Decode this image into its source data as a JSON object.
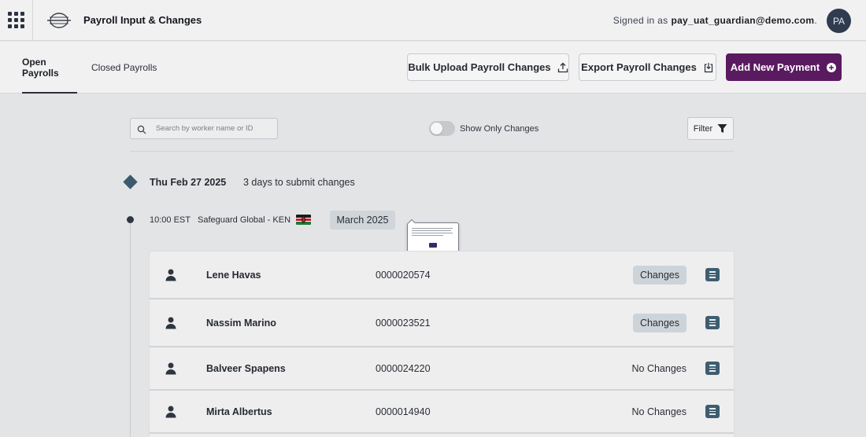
{
  "app": {
    "title": "Payroll Input & Changes",
    "signed_in_prefix": "Signed in as",
    "user_email": "pay_uat_guardian@demo.com",
    "signed_in_suffix": ".",
    "avatar_initials": "PA"
  },
  "tabs": [
    {
      "label": "Open Payrolls",
      "active": true
    },
    {
      "label": "Closed Payrolls",
      "active": false
    }
  ],
  "actions": {
    "bulk_upload": "Bulk Upload Payroll Changes",
    "export": "Export Payroll Changes",
    "add_payment": "Add New Payment"
  },
  "filters": {
    "search_placeholder": "Search by worker name or ID",
    "toggle_label": "Show Only Changes",
    "toggle_on": false,
    "filter_label": "Filter"
  },
  "group": {
    "date": "Thu Feb 27 2025",
    "deadline": "3 days to submit changes",
    "time": "10:00 EST",
    "entity": "Safeguard Global - KEN",
    "country_flag": "kenya-flag",
    "period": "March 2025"
  },
  "workers": [
    {
      "name": "Lene Havas",
      "id": "0000020574",
      "status": "Changes",
      "has_changes": true
    },
    {
      "name": "Nassim Marino",
      "id": "0000023521",
      "status": "Changes",
      "has_changes": true
    },
    {
      "name": "Balveer Spapens",
      "id": "0000024220",
      "status": "No Changes",
      "has_changes": false
    },
    {
      "name": "Mirta Albertus",
      "id": "0000014940",
      "status": "No Changes",
      "has_changes": false
    }
  ],
  "colors": {
    "primary": "#5a1a60",
    "accent": "#3f5d70",
    "chip": "#cdd4d9",
    "background": "#e3e4e6"
  }
}
